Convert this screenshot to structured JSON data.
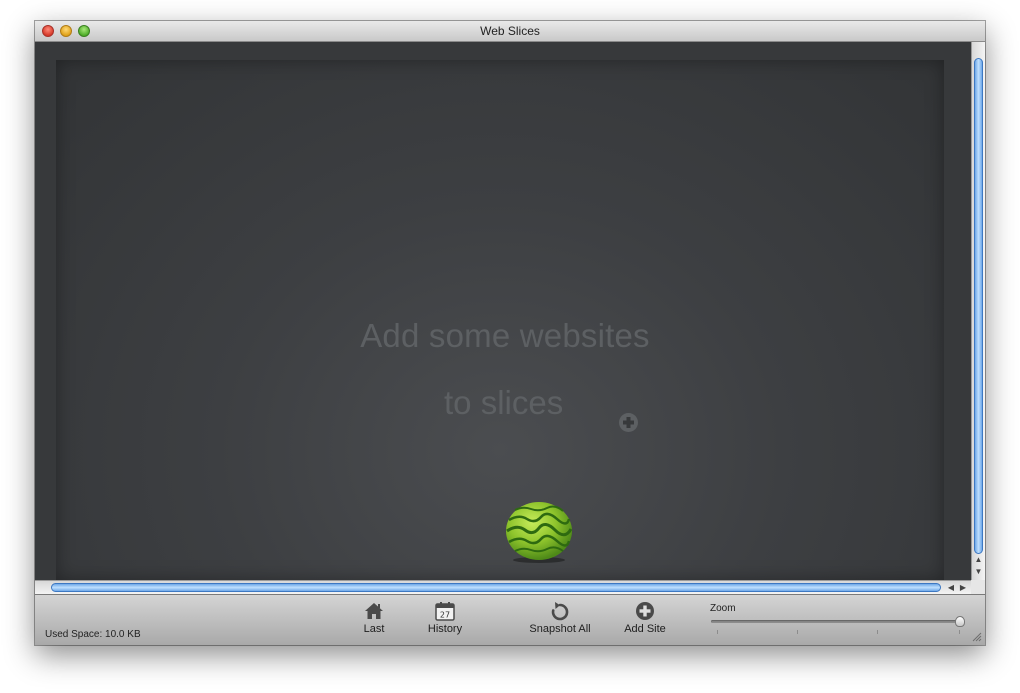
{
  "window": {
    "title": "Web Slices"
  },
  "content": {
    "empty_line1": "Add some websites",
    "empty_line2": "to slices"
  },
  "toolbar": {
    "used_space": "Used Space: 10.0 KB",
    "last_label": "Last",
    "history_label": "History",
    "history_day": "27",
    "snapshot_label": "Snapshot All",
    "add_site_label": "Add Site",
    "zoom_label": "Zoom",
    "zoom_level": 1.0
  },
  "colors": {
    "content_bg": "#3b3d40",
    "scroll_thumb": "#6fa8e8",
    "empty_text": "#5d6063"
  }
}
